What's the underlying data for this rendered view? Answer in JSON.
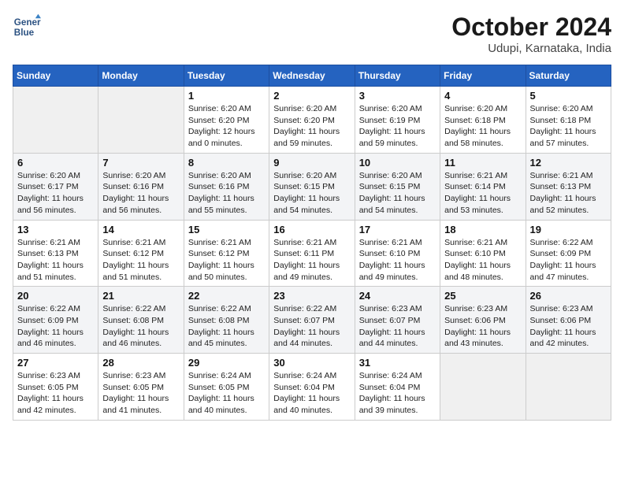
{
  "header": {
    "logo_line1": "General",
    "logo_line2": "Blue",
    "title": "October 2024",
    "subtitle": "Udupi, Karnataka, India"
  },
  "weekdays": [
    "Sunday",
    "Monday",
    "Tuesday",
    "Wednesday",
    "Thursday",
    "Friday",
    "Saturday"
  ],
  "weeks": [
    [
      {
        "day": "",
        "sunrise": "",
        "sunset": "",
        "daylight": ""
      },
      {
        "day": "",
        "sunrise": "",
        "sunset": "",
        "daylight": ""
      },
      {
        "day": "1",
        "sunrise": "Sunrise: 6:20 AM",
        "sunset": "Sunset: 6:20 PM",
        "daylight": "Daylight: 12 hours and 0 minutes."
      },
      {
        "day": "2",
        "sunrise": "Sunrise: 6:20 AM",
        "sunset": "Sunset: 6:20 PM",
        "daylight": "Daylight: 11 hours and 59 minutes."
      },
      {
        "day": "3",
        "sunrise": "Sunrise: 6:20 AM",
        "sunset": "Sunset: 6:19 PM",
        "daylight": "Daylight: 11 hours and 59 minutes."
      },
      {
        "day": "4",
        "sunrise": "Sunrise: 6:20 AM",
        "sunset": "Sunset: 6:18 PM",
        "daylight": "Daylight: 11 hours and 58 minutes."
      },
      {
        "day": "5",
        "sunrise": "Sunrise: 6:20 AM",
        "sunset": "Sunset: 6:18 PM",
        "daylight": "Daylight: 11 hours and 57 minutes."
      }
    ],
    [
      {
        "day": "6",
        "sunrise": "Sunrise: 6:20 AM",
        "sunset": "Sunset: 6:17 PM",
        "daylight": "Daylight: 11 hours and 56 minutes."
      },
      {
        "day": "7",
        "sunrise": "Sunrise: 6:20 AM",
        "sunset": "Sunset: 6:16 PM",
        "daylight": "Daylight: 11 hours and 56 minutes."
      },
      {
        "day": "8",
        "sunrise": "Sunrise: 6:20 AM",
        "sunset": "Sunset: 6:16 PM",
        "daylight": "Daylight: 11 hours and 55 minutes."
      },
      {
        "day": "9",
        "sunrise": "Sunrise: 6:20 AM",
        "sunset": "Sunset: 6:15 PM",
        "daylight": "Daylight: 11 hours and 54 minutes."
      },
      {
        "day": "10",
        "sunrise": "Sunrise: 6:20 AM",
        "sunset": "Sunset: 6:15 PM",
        "daylight": "Daylight: 11 hours and 54 minutes."
      },
      {
        "day": "11",
        "sunrise": "Sunrise: 6:21 AM",
        "sunset": "Sunset: 6:14 PM",
        "daylight": "Daylight: 11 hours and 53 minutes."
      },
      {
        "day": "12",
        "sunrise": "Sunrise: 6:21 AM",
        "sunset": "Sunset: 6:13 PM",
        "daylight": "Daylight: 11 hours and 52 minutes."
      }
    ],
    [
      {
        "day": "13",
        "sunrise": "Sunrise: 6:21 AM",
        "sunset": "Sunset: 6:13 PM",
        "daylight": "Daylight: 11 hours and 51 minutes."
      },
      {
        "day": "14",
        "sunrise": "Sunrise: 6:21 AM",
        "sunset": "Sunset: 6:12 PM",
        "daylight": "Daylight: 11 hours and 51 minutes."
      },
      {
        "day": "15",
        "sunrise": "Sunrise: 6:21 AM",
        "sunset": "Sunset: 6:12 PM",
        "daylight": "Daylight: 11 hours and 50 minutes."
      },
      {
        "day": "16",
        "sunrise": "Sunrise: 6:21 AM",
        "sunset": "Sunset: 6:11 PM",
        "daylight": "Daylight: 11 hours and 49 minutes."
      },
      {
        "day": "17",
        "sunrise": "Sunrise: 6:21 AM",
        "sunset": "Sunset: 6:10 PM",
        "daylight": "Daylight: 11 hours and 49 minutes."
      },
      {
        "day": "18",
        "sunrise": "Sunrise: 6:21 AM",
        "sunset": "Sunset: 6:10 PM",
        "daylight": "Daylight: 11 hours and 48 minutes."
      },
      {
        "day": "19",
        "sunrise": "Sunrise: 6:22 AM",
        "sunset": "Sunset: 6:09 PM",
        "daylight": "Daylight: 11 hours and 47 minutes."
      }
    ],
    [
      {
        "day": "20",
        "sunrise": "Sunrise: 6:22 AM",
        "sunset": "Sunset: 6:09 PM",
        "daylight": "Daylight: 11 hours and 46 minutes."
      },
      {
        "day": "21",
        "sunrise": "Sunrise: 6:22 AM",
        "sunset": "Sunset: 6:08 PM",
        "daylight": "Daylight: 11 hours and 46 minutes."
      },
      {
        "day": "22",
        "sunrise": "Sunrise: 6:22 AM",
        "sunset": "Sunset: 6:08 PM",
        "daylight": "Daylight: 11 hours and 45 minutes."
      },
      {
        "day": "23",
        "sunrise": "Sunrise: 6:22 AM",
        "sunset": "Sunset: 6:07 PM",
        "daylight": "Daylight: 11 hours and 44 minutes."
      },
      {
        "day": "24",
        "sunrise": "Sunrise: 6:23 AM",
        "sunset": "Sunset: 6:07 PM",
        "daylight": "Daylight: 11 hours and 44 minutes."
      },
      {
        "day": "25",
        "sunrise": "Sunrise: 6:23 AM",
        "sunset": "Sunset: 6:06 PM",
        "daylight": "Daylight: 11 hours and 43 minutes."
      },
      {
        "day": "26",
        "sunrise": "Sunrise: 6:23 AM",
        "sunset": "Sunset: 6:06 PM",
        "daylight": "Daylight: 11 hours and 42 minutes."
      }
    ],
    [
      {
        "day": "27",
        "sunrise": "Sunrise: 6:23 AM",
        "sunset": "Sunset: 6:05 PM",
        "daylight": "Daylight: 11 hours and 42 minutes."
      },
      {
        "day": "28",
        "sunrise": "Sunrise: 6:23 AM",
        "sunset": "Sunset: 6:05 PM",
        "daylight": "Daylight: 11 hours and 41 minutes."
      },
      {
        "day": "29",
        "sunrise": "Sunrise: 6:24 AM",
        "sunset": "Sunset: 6:05 PM",
        "daylight": "Daylight: 11 hours and 40 minutes."
      },
      {
        "day": "30",
        "sunrise": "Sunrise: 6:24 AM",
        "sunset": "Sunset: 6:04 PM",
        "daylight": "Daylight: 11 hours and 40 minutes."
      },
      {
        "day": "31",
        "sunrise": "Sunrise: 6:24 AM",
        "sunset": "Sunset: 6:04 PM",
        "daylight": "Daylight: 11 hours and 39 minutes."
      },
      {
        "day": "",
        "sunrise": "",
        "sunset": "",
        "daylight": ""
      },
      {
        "day": "",
        "sunrise": "",
        "sunset": "",
        "daylight": ""
      }
    ]
  ]
}
